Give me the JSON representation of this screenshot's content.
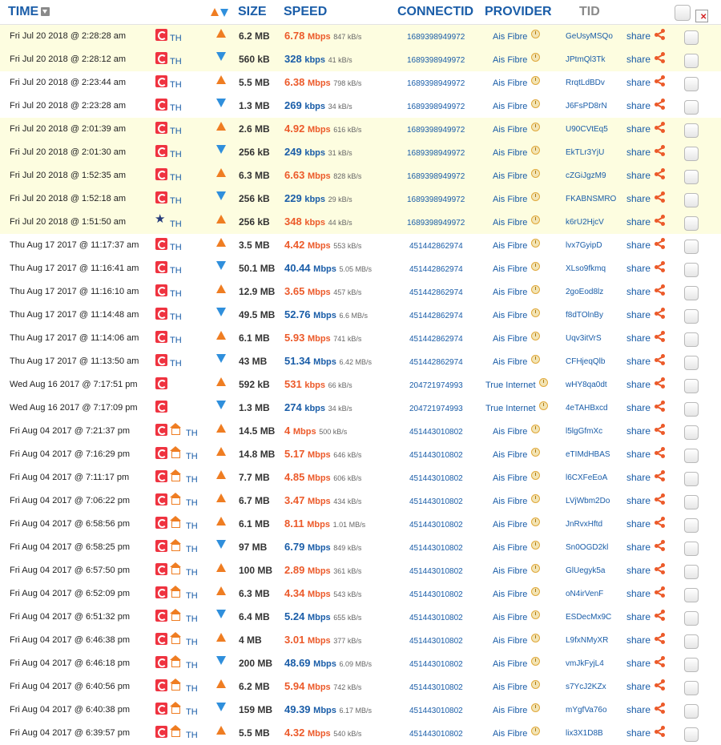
{
  "header": {
    "time": "TIME",
    "size": "SIZE",
    "speed": "SPEED",
    "connect_id": "CONNECTID",
    "provider": "PROVIDER",
    "tid": "TID"
  },
  "colors": {
    "upload": "#ef7d22",
    "download": "#2f8fdc",
    "link": "#1a5da8",
    "highlight_row": "#fdfde0"
  },
  "rows": [
    {
      "time": "Fri Jul 20 2018 @ 2:28:28 am",
      "cc": "TH",
      "dir": "up",
      "size": "6.2 MB",
      "speed": "6.78",
      "unit": "Mbps",
      "kbps": "847 kB/s",
      "cid": "1689398949972",
      "provider": "Ais Fibre",
      "tid": "GeUsyMSQo",
      "share": "share",
      "icon": "sg-flag",
      "hl": true
    },
    {
      "time": "Fri Jul 20 2018 @ 2:28:12 am",
      "cc": "TH",
      "dir": "down",
      "size": "560 kB",
      "speed": "328",
      "unit": "kbps",
      "kbps": "41 kB/s",
      "cid": "1689398949972",
      "provider": "Ais Fibre",
      "tid": "JPtmQl3Tk",
      "share": "share",
      "icon": "sg-flag",
      "hl": true
    },
    {
      "time": "Fri Jul 20 2018 @ 2:23:44 am",
      "cc": "TH",
      "dir": "up",
      "size": "5.5 MB",
      "speed": "6.38",
      "unit": "Mbps",
      "kbps": "798 kB/s",
      "cid": "1689398949972",
      "provider": "Ais Fibre",
      "tid": "RrqtLdBDv",
      "share": "share",
      "icon": "sg-flag",
      "hl": false
    },
    {
      "time": "Fri Jul 20 2018 @ 2:23:28 am",
      "cc": "TH",
      "dir": "down",
      "size": "1.3 MB",
      "speed": "269",
      "unit": "kbps",
      "kbps": "34 kB/s",
      "cid": "1689398949972",
      "provider": "Ais Fibre",
      "tid": "J6FsPD8rN",
      "share": "share",
      "icon": "sg-flag",
      "hl": false
    },
    {
      "time": "Fri Jul 20 2018 @ 2:01:39 am",
      "cc": "TH",
      "dir": "up",
      "size": "2.6 MB",
      "speed": "4.92",
      "unit": "Mbps",
      "kbps": "616 kB/s",
      "cid": "1689398949972",
      "provider": "Ais Fibre",
      "tid": "U90CVtEq5",
      "share": "share",
      "icon": "sg-flag",
      "hl": true
    },
    {
      "time": "Fri Jul 20 2018 @ 2:01:30 am",
      "cc": "TH",
      "dir": "down",
      "size": "256 kB",
      "speed": "249",
      "unit": "kbps",
      "kbps": "31 kB/s",
      "cid": "1689398949972",
      "provider": "Ais Fibre",
      "tid": "EkTLr3YjU",
      "share": "share",
      "icon": "sg-flag",
      "hl": true
    },
    {
      "time": "Fri Jul 20 2018 @ 1:52:35 am",
      "cc": "TH",
      "dir": "up",
      "size": "6.3 MB",
      "speed": "6.63",
      "unit": "Mbps",
      "kbps": "828 kB/s",
      "cid": "1689398949972",
      "provider": "Ais Fibre",
      "tid": "cZGiJgzM9",
      "share": "share",
      "icon": "sg-flag",
      "hl": true
    },
    {
      "time": "Fri Jul 20 2018 @ 1:52:18 am",
      "cc": "TH",
      "dir": "down",
      "size": "256 kB",
      "speed": "229",
      "unit": "kbps",
      "kbps": "29 kB/s",
      "cid": "1689398949972",
      "provider": "Ais Fibre",
      "tid": "FKABNSMRO",
      "share": "share",
      "icon": "sg-flag",
      "hl": true
    },
    {
      "time": "Fri Jul 20 2018 @ 1:51:50 am",
      "cc": "TH",
      "dir": "up",
      "size": "256 kB",
      "speed": "348",
      "unit": "kbps",
      "kbps": "44 kB/s",
      "cid": "1689398949972",
      "provider": "Ais Fibre",
      "tid": "k6rU2HjcV",
      "share": "share",
      "icon": "star",
      "hl": true
    },
    {
      "time": "Thu Aug 17 2017 @ 11:17:37 am",
      "cc": "TH",
      "dir": "up",
      "size": "3.5 MB",
      "speed": "4.42",
      "unit": "Mbps",
      "kbps": "553 kB/s",
      "cid": "451442862974",
      "provider": "Ais Fibre",
      "tid": "lvx7GyipD",
      "share": "share",
      "icon": "sg-flag",
      "hl": false
    },
    {
      "time": "Thu Aug 17 2017 @ 11:16:41 am",
      "cc": "TH",
      "dir": "down",
      "size": "50.1 MB",
      "speed": "40.44",
      "unit": "Mbps",
      "kbps": "5.05 MB/s",
      "cid": "451442862974",
      "provider": "Ais Fibre",
      "tid": "XLso9fkmq",
      "share": "share",
      "icon": "sg-flag",
      "hl": false
    },
    {
      "time": "Thu Aug 17 2017 @ 11:16:10 am",
      "cc": "TH",
      "dir": "up",
      "size": "12.9 MB",
      "speed": "3.65",
      "unit": "Mbps",
      "kbps": "457 kB/s",
      "cid": "451442862974",
      "provider": "Ais Fibre",
      "tid": "2goEod8lz",
      "share": "share",
      "icon": "sg-flag",
      "hl": false
    },
    {
      "time": "Thu Aug 17 2017 @ 11:14:48 am",
      "cc": "TH",
      "dir": "down",
      "size": "49.5 MB",
      "speed": "52.76",
      "unit": "Mbps",
      "kbps": "6.6 MB/s",
      "cid": "451442862974",
      "provider": "Ais Fibre",
      "tid": "f8dTOlnBy",
      "share": "share",
      "icon": "sg-flag",
      "hl": false
    },
    {
      "time": "Thu Aug 17 2017 @ 11:14:06 am",
      "cc": "TH",
      "dir": "up",
      "size": "6.1 MB",
      "speed": "5.93",
      "unit": "Mbps",
      "kbps": "741 kB/s",
      "cid": "451442862974",
      "provider": "Ais Fibre",
      "tid": "Uqv3itVrS",
      "share": "share",
      "icon": "sg-flag",
      "hl": false
    },
    {
      "time": "Thu Aug 17 2017 @ 11:13:50 am",
      "cc": "TH",
      "dir": "down",
      "size": "43 MB",
      "speed": "51.34",
      "unit": "Mbps",
      "kbps": "6.42 MB/s",
      "cid": "451442862974",
      "provider": "Ais Fibre",
      "tid": "CFHjeqQlb",
      "share": "share",
      "icon": "sg-flag",
      "hl": false
    },
    {
      "time": "Wed Aug 16 2017 @ 7:17:51 pm",
      "cc": "",
      "dir": "up",
      "size": "592 kB",
      "speed": "531",
      "unit": "kbps",
      "kbps": "66 kB/s",
      "cid": "204721974993",
      "provider": "True Internet",
      "tid": "wHY8qa0dt",
      "share": "share",
      "icon": "sg-flag",
      "hl": false
    },
    {
      "time": "Wed Aug 16 2017 @ 7:17:09 pm",
      "cc": "",
      "dir": "down",
      "size": "1.3 MB",
      "speed": "274",
      "unit": "kbps",
      "kbps": "34 kB/s",
      "cid": "204721974993",
      "provider": "True Internet",
      "tid": "4eTAHBxcd",
      "share": "share",
      "icon": "sg-flag",
      "hl": false
    },
    {
      "time": "Fri Aug 04 2017 @ 7:21:37 pm",
      "cc": "TH",
      "dir": "up",
      "size": "14.5 MB",
      "speed": "4",
      "unit": "Mbps",
      "kbps": "500 kB/s",
      "cid": "451443010802",
      "provider": "Ais Fibre",
      "tid": "l5lgGfmXc",
      "share": "share",
      "icon": "sg-flag-home",
      "hl": false
    },
    {
      "time": "Fri Aug 04 2017 @ 7:16:29 pm",
      "cc": "TH",
      "dir": "up",
      "size": "14.8 MB",
      "speed": "5.17",
      "unit": "Mbps",
      "kbps": "646 kB/s",
      "cid": "451443010802",
      "provider": "Ais Fibre",
      "tid": "eTIMdHBAS",
      "share": "share",
      "icon": "sg-flag-home",
      "hl": false
    },
    {
      "time": "Fri Aug 04 2017 @ 7:11:17 pm",
      "cc": "TH",
      "dir": "up",
      "size": "7.7 MB",
      "speed": "4.85",
      "unit": "Mbps",
      "kbps": "606 kB/s",
      "cid": "451443010802",
      "provider": "Ais Fibre",
      "tid": "l6CXFeEoA",
      "share": "share",
      "icon": "sg-flag-home",
      "hl": false
    },
    {
      "time": "Fri Aug 04 2017 @ 7:06:22 pm",
      "cc": "TH",
      "dir": "up",
      "size": "6.7 MB",
      "speed": "3.47",
      "unit": "Mbps",
      "kbps": "434 kB/s",
      "cid": "451443010802",
      "provider": "Ais Fibre",
      "tid": "LVjWbm2Do",
      "share": "share",
      "icon": "sg-flag-home",
      "hl": false
    },
    {
      "time": "Fri Aug 04 2017 @ 6:58:56 pm",
      "cc": "TH",
      "dir": "up",
      "size": "6.1 MB",
      "speed": "8.11",
      "unit": "Mbps",
      "kbps": "1.01 MB/s",
      "cid": "451443010802",
      "provider": "Ais Fibre",
      "tid": "JnRvxHftd",
      "share": "share",
      "icon": "sg-flag-home",
      "hl": false
    },
    {
      "time": "Fri Aug 04 2017 @ 6:58:25 pm",
      "cc": "TH",
      "dir": "down",
      "size": "97 MB",
      "speed": "6.79",
      "unit": "Mbps",
      "kbps": "849 kB/s",
      "cid": "451443010802",
      "provider": "Ais Fibre",
      "tid": "Sn0OGD2kl",
      "share": "share",
      "icon": "sg-flag-home",
      "hl": false
    },
    {
      "time": "Fri Aug 04 2017 @ 6:57:50 pm",
      "cc": "TH",
      "dir": "up",
      "size": "100 MB",
      "speed": "2.89",
      "unit": "Mbps",
      "kbps": "361 kB/s",
      "cid": "451443010802",
      "provider": "Ais Fibre",
      "tid": "GlUegyk5a",
      "share": "share",
      "icon": "sg-flag-home",
      "hl": false
    },
    {
      "time": "Fri Aug 04 2017 @ 6:52:09 pm",
      "cc": "TH",
      "dir": "up",
      "size": "6.3 MB",
      "speed": "4.34",
      "unit": "Mbps",
      "kbps": "543 kB/s",
      "cid": "451443010802",
      "provider": "Ais Fibre",
      "tid": "oN4irVenF",
      "share": "share",
      "icon": "sg-flag-home",
      "hl": false
    },
    {
      "time": "Fri Aug 04 2017 @ 6:51:32 pm",
      "cc": "TH",
      "dir": "down",
      "size": "6.4 MB",
      "speed": "5.24",
      "unit": "Mbps",
      "kbps": "655 kB/s",
      "cid": "451443010802",
      "provider": "Ais Fibre",
      "tid": "ESDecMx9C",
      "share": "share",
      "icon": "sg-flag-home",
      "hl": false
    },
    {
      "time": "Fri Aug 04 2017 @ 6:46:38 pm",
      "cc": "TH",
      "dir": "up",
      "size": "4 MB",
      "speed": "3.01",
      "unit": "Mbps",
      "kbps": "377 kB/s",
      "cid": "451443010802",
      "provider": "Ais Fibre",
      "tid": "L9fxNMyXR",
      "share": "share",
      "icon": "sg-flag-home",
      "hl": false
    },
    {
      "time": "Fri Aug 04 2017 @ 6:46:18 pm",
      "cc": "TH",
      "dir": "down",
      "size": "200 MB",
      "speed": "48.69",
      "unit": "Mbps",
      "kbps": "6.09 MB/s",
      "cid": "451443010802",
      "provider": "Ais Fibre",
      "tid": "vmJkFyjL4",
      "share": "share",
      "icon": "sg-flag-home",
      "hl": false
    },
    {
      "time": "Fri Aug 04 2017 @ 6:40:56 pm",
      "cc": "TH",
      "dir": "up",
      "size": "6.2 MB",
      "speed": "5.94",
      "unit": "Mbps",
      "kbps": "742 kB/s",
      "cid": "451443010802",
      "provider": "Ais Fibre",
      "tid": "s7YcJ2KZx",
      "share": "share",
      "icon": "sg-flag-home",
      "hl": false
    },
    {
      "time": "Fri Aug 04 2017 @ 6:40:38 pm",
      "cc": "TH",
      "dir": "down",
      "size": "159 MB",
      "speed": "49.39",
      "unit": "Mbps",
      "kbps": "6.17 MB/s",
      "cid": "451443010802",
      "provider": "Ais Fibre",
      "tid": "mYgfVa76o",
      "share": "share",
      "icon": "sg-flag-home",
      "hl": false
    },
    {
      "time": "Fri Aug 04 2017 @ 6:39:57 pm",
      "cc": "TH",
      "dir": "up",
      "size": "5.5 MB",
      "speed": "4.32",
      "unit": "Mbps",
      "kbps": "540 kB/s",
      "cid": "451443010802",
      "provider": "Ais Fibre",
      "tid": "lix3X1D8B",
      "share": "share",
      "icon": "sg-flag-home",
      "hl": false
    }
  ]
}
